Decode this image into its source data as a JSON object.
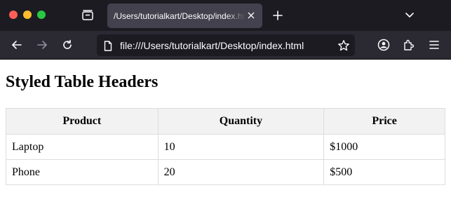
{
  "browser": {
    "tab": {
      "title": "/Users/tutorialkart/Desktop/index.html"
    },
    "url": "file:///Users/tutorialkart/Desktop/index.html",
    "colors": {
      "tabstrip": "#1c1b22",
      "navbar": "#2b2a33",
      "active_tab": "#42414d",
      "close": "#ff5f57",
      "minimize": "#febc2e",
      "zoom": "#28c840"
    },
    "icons": [
      "close-window",
      "minimize-window",
      "zoom-window",
      "firefox-view",
      "close-tab",
      "new-tab",
      "tab-list-chevron",
      "back",
      "forward",
      "reload",
      "page-file",
      "bookmark-star",
      "account",
      "extensions",
      "menu"
    ]
  },
  "page": {
    "title": "Styled Table Headers",
    "table": {
      "headers": [
        "Product",
        "Quantity",
        "Price"
      ],
      "rows": [
        [
          "Laptop",
          "10",
          "$1000"
        ],
        [
          "Phone",
          "20",
          "$500"
        ]
      ],
      "colors": {
        "header_bg": "#f2f2f2",
        "border": "#dddddd"
      }
    }
  }
}
